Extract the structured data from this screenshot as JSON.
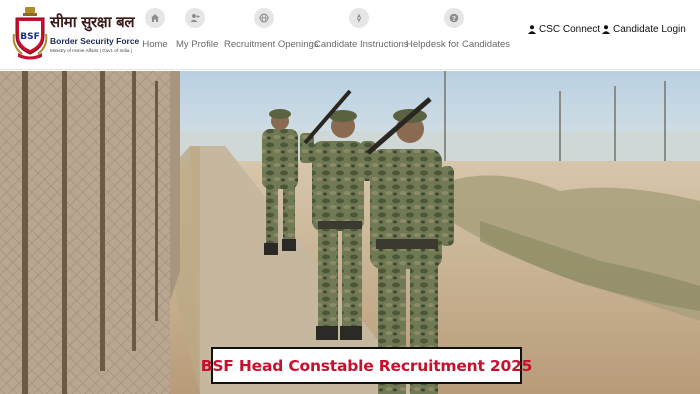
{
  "logo": {
    "badge_text": "BSF",
    "hindi_title": "सीमा सुरक्षा बल",
    "english_title": "Border Security Force",
    "ministry": "Ministry of Home Affairs | Govt. of India |"
  },
  "nav": {
    "items": [
      {
        "label": "Home",
        "icon": "home-icon"
      },
      {
        "label": "My Profile",
        "icon": "user-plus-icon"
      },
      {
        "label": "Recruitment Openings",
        "icon": "globe-icon"
      },
      {
        "label": "Candidate Instructions",
        "icon": "compass-icon"
      },
      {
        "label": "Helpdesk for Candidates",
        "icon": "question-icon"
      }
    ]
  },
  "header_links": {
    "csc": "CSC Connect",
    "candidate_login": "Candidate Login"
  },
  "hero": {
    "caption": "BSF Head Constable Recruitment 2025"
  },
  "colors": {
    "caption_text": "#c8102e",
    "nav_text": "#6a6a6a",
    "nav_circle": "#e6e6e6",
    "sky": "#c9dbe8",
    "ground": "#cdb79b"
  }
}
